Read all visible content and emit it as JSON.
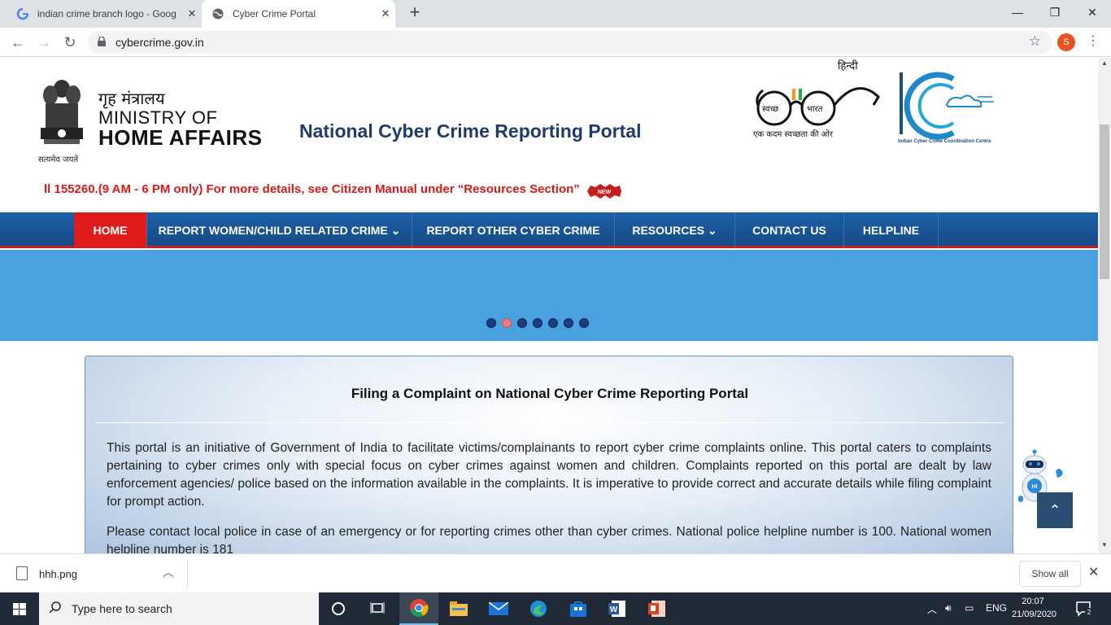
{
  "browser": {
    "tabs": [
      {
        "title": "indian crime branch logo - Goog",
        "favicon": "google-g-icon"
      },
      {
        "title": "Cyber Crime Portal",
        "favicon": "globe-icon"
      }
    ],
    "url": "cybercrime.gov.in",
    "profile_initial": "S"
  },
  "header": {
    "ministry_hindi": "गृह मंत्रालय",
    "ministry_line1": "MINISTRY OF",
    "ministry_line2": "HOME AFFAIRS",
    "emblem_motto": "सत्यमेव जयते",
    "portal_title": "National Cyber Crime Reporting Portal",
    "language_link": "हिन्दी",
    "swachh_tagline": "एक कदम स्वच्छता की ओर",
    "swachh_left": "स्वच्छ",
    "swachh_right": "भारत",
    "i4c_caption": "Indian Cyber Crime Coordination Centre"
  },
  "notice": {
    "text": "ll 155260.(9 AM - 6 PM only) For more details, see Citizen Manual under “Resources Section”",
    "badge": "NEW"
  },
  "nav": {
    "items": [
      {
        "label": "HOME",
        "active": true
      },
      {
        "label": "REPORT WOMEN/CHILD RELATED CRIME ⌄",
        "active": false
      },
      {
        "label": "REPORT OTHER CYBER CRIME",
        "active": false
      },
      {
        "label": "RESOURCES ⌄",
        "active": false
      },
      {
        "label": "CONTACT US",
        "active": false
      },
      {
        "label": "HELPLINE",
        "active": false
      }
    ]
  },
  "carousel": {
    "slide_count": 7,
    "current_slide": 2
  },
  "info_card": {
    "title": "Filing a Complaint on National Cyber Crime Reporting Portal",
    "para1": "This portal is an initiative of Government of India to facilitate victims/complainants to report cyber crime complaints online. This portal caters to complaints pertaining to cyber crimes only with special focus on cyber crimes against women and children. Complaints reported on this portal are dealt by law enforcement agencies/ police based on the information available in the complaints. It is imperative to provide correct and accurate details while filing complaint for prompt action.",
    "para2": "Please contact local police in case of an emergency or for reporting crimes other than cyber crimes. National police helpline number is 100. National women helpline number is 181"
  },
  "chatbot": {
    "label": "HI"
  },
  "downloads": {
    "file": "hhh.png",
    "show_all": "Show all"
  },
  "taskbar": {
    "search_placeholder": "Type here to search",
    "language": "ENG",
    "time": "20:07",
    "date": "21/09/2020",
    "notification_count": "2"
  },
  "colors": {
    "nav_bg": "#1c5fa8",
    "nav_active": "#e01b1b",
    "banner": "#4aa1e0",
    "title_blue": "#1f3a6e",
    "notice_red": "#d61a1a"
  }
}
